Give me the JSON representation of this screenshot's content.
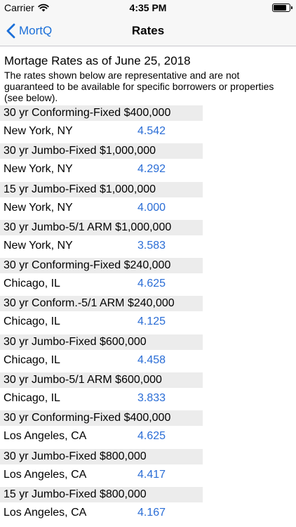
{
  "status_bar": {
    "carrier": "Carrier",
    "time": "4:35 PM",
    "battery_level": 0.92
  },
  "nav_bar": {
    "back_label": "MortQ",
    "title": "Rates"
  },
  "heading": "Mortage Rates as of June 25, 2018",
  "disclaimer": "The rates shown below are representative and are not guaranteed to be available for specific borrowers or properties (see below).",
  "rates": [
    {
      "product": "30 yr Conforming-Fixed $400,000",
      "city": "New York, NY",
      "rate": "4.542"
    },
    {
      "product": "30 yr Jumbo-Fixed $1,000,000",
      "city": "New York, NY",
      "rate": "4.292"
    },
    {
      "product": "15 yr Jumbo-Fixed $1,000,000",
      "city": "New York, NY",
      "rate": "4.000"
    },
    {
      "product": "30 yr Jumbo-5/1 ARM $1,000,000",
      "city": "New York, NY",
      "rate": "3.583"
    },
    {
      "product": "30 yr Conforming-Fixed $240,000",
      "city": "Chicago, IL",
      "rate": "4.625"
    },
    {
      "product": "30 yr Conform.-5/1 ARM $240,000",
      "city": "Chicago, IL",
      "rate": "4.125"
    },
    {
      "product": "30 yr Jumbo-Fixed $600,000",
      "city": "Chicago, IL",
      "rate": "4.458"
    },
    {
      "product": "30 yr Jumbo-5/1 ARM $600,000",
      "city": "Chicago, IL",
      "rate": "3.833"
    },
    {
      "product": "30 yr Conforming-Fixed $400,000",
      "city": "Los Angeles, CA",
      "rate": "4.625"
    },
    {
      "product": "30 yr Jumbo-Fixed $800,000",
      "city": "Los Angeles, CA",
      "rate": "4.417"
    },
    {
      "product": "15 yr Jumbo-Fixed $800,000",
      "city": "Los Angeles, CA",
      "rate": "4.167"
    }
  ],
  "colors": {
    "link_blue": "#1b6fd8",
    "rate_blue": "#2a6dd6",
    "section_bg": "#ececec",
    "bar_bg": "#f7f7f7"
  }
}
